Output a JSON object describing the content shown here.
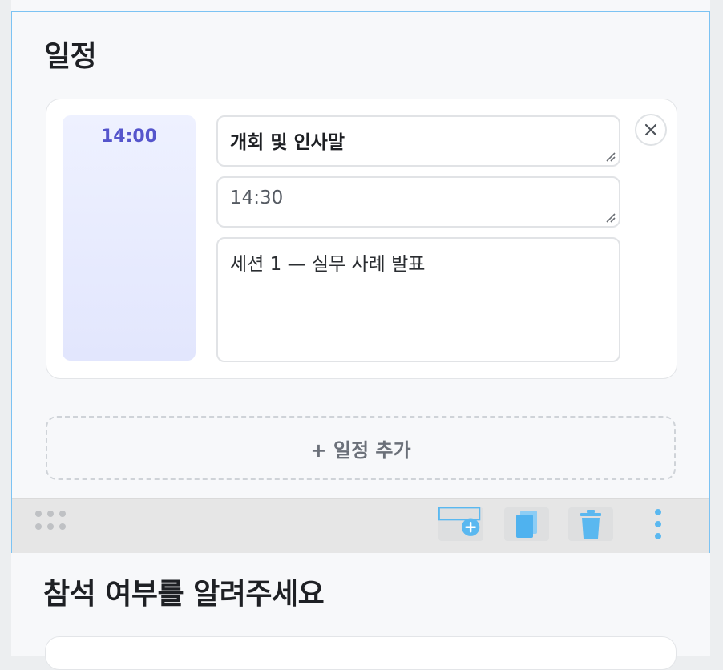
{
  "schedule": {
    "title": "일정",
    "item": {
      "start_time": "14:00",
      "title_value": "개회 및 인사말",
      "end_time_value": "14:30",
      "description_value": "세션 1 — 실무 사례 발표"
    },
    "add_label": "+ 일정 추가"
  },
  "toolbar": {
    "icons": [
      "drag-handle-icon",
      "add-block-icon",
      "duplicate-icon",
      "trash-icon",
      "more-vertical-icon"
    ],
    "accent_color": "#5ab8f0"
  },
  "next_section": {
    "title": "참석 여부를 알려주세요"
  },
  "colors": {
    "selection_border": "#7cc3f3",
    "time_text": "#5555cc",
    "time_pill_bg": "#e8ebfe"
  }
}
